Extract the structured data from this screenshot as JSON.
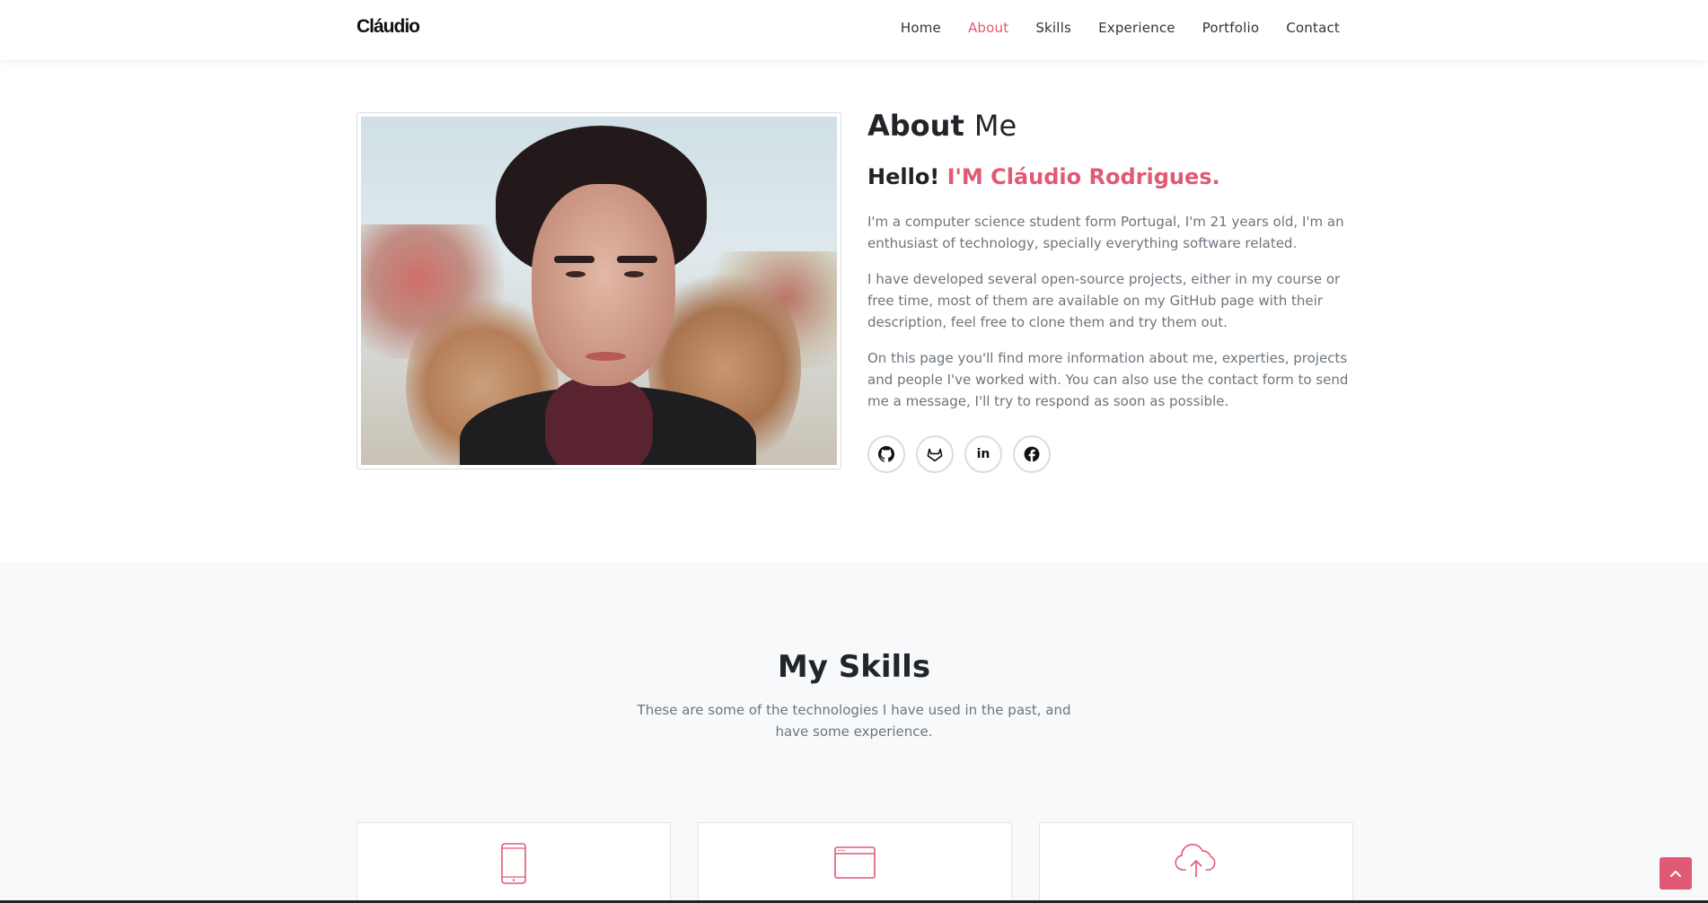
{
  "navbar": {
    "brand": "Cláudio",
    "links": [
      "Home",
      "About",
      "Skills",
      "Experience",
      "Portfolio",
      "Contact"
    ],
    "active": "About"
  },
  "about": {
    "title_bold": "About",
    "title_light": "Me",
    "hello": "Hello!",
    "name": "I'M Cláudio Rodrigues.",
    "paragraphs": [
      "I'm a computer science student form Portugal, I'm 21 years old, I'm an enthusiast of technology, specially everything software related.",
      "I have developed several open-source projects, either in my course or free time, most of them are available on my GitHub page with their description, feel free to clone them and try them out.",
      "On this page you'll find more information about me, experties, projects and people I've worked with. You can also use the contact form to send me a message, I'll try to respond as soon as possible."
    ],
    "socials": [
      {
        "icon": "github-icon",
        "glyph": "GH"
      },
      {
        "icon": "gitlab-icon",
        "glyph": "GL"
      },
      {
        "icon": "linkedin-icon",
        "glyph": "in"
      },
      {
        "icon": "facebook-icon",
        "glyph": "f"
      }
    ]
  },
  "skills": {
    "title_light": "My",
    "title_bold": "Skills",
    "subtitle": "These are some of the technologies I have used in the past, and have some experience.",
    "cards": [
      {
        "icon": "mobile-icon"
      },
      {
        "icon": "browser-window-icon"
      },
      {
        "icon": "cloud-upload-icon"
      }
    ]
  },
  "colors": {
    "accent": "#e05a75",
    "text_muted": "#6c757d",
    "section_bg": "#f8f9fa"
  }
}
